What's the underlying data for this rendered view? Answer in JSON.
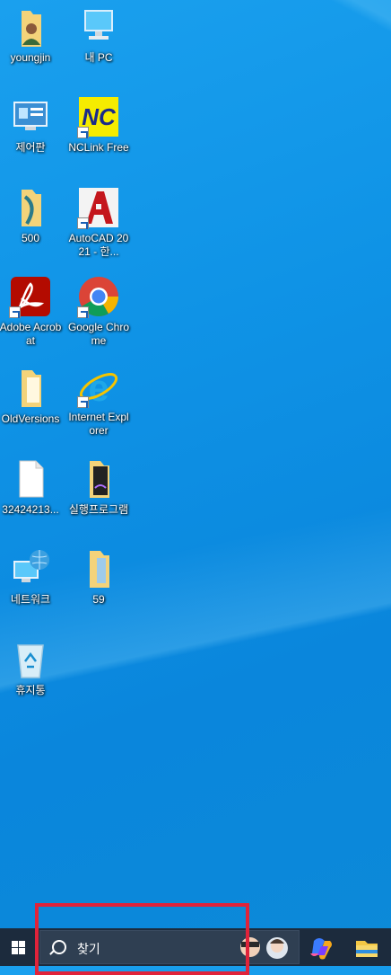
{
  "desktop": {
    "icons": [
      {
        "label": "youngjin"
      },
      {
        "label": "내 PC"
      },
      {
        "label": "제어판"
      },
      {
        "label": "NCLink Free"
      },
      {
        "label": "500"
      },
      {
        "label": "AutoCAD 2021 - 한..."
      },
      {
        "label": "Adobe Acrobat"
      },
      {
        "label": "Google Chrome"
      },
      {
        "label": "OldVersions"
      },
      {
        "label": "Internet Explorer"
      },
      {
        "label": "32424213..."
      },
      {
        "label": "실행프로그램"
      },
      {
        "label": "네트워크"
      },
      {
        "label": "59"
      },
      {
        "label": "휴지통"
      }
    ]
  },
  "taskbar": {
    "search_placeholder": "찾기",
    "apps": [
      "copilot-icon",
      "file-explorer-icon"
    ]
  },
  "colors": {
    "desktop_blue": "#0f93e6",
    "taskbar": "#1c2b3d",
    "highlight": "#e0233a"
  }
}
